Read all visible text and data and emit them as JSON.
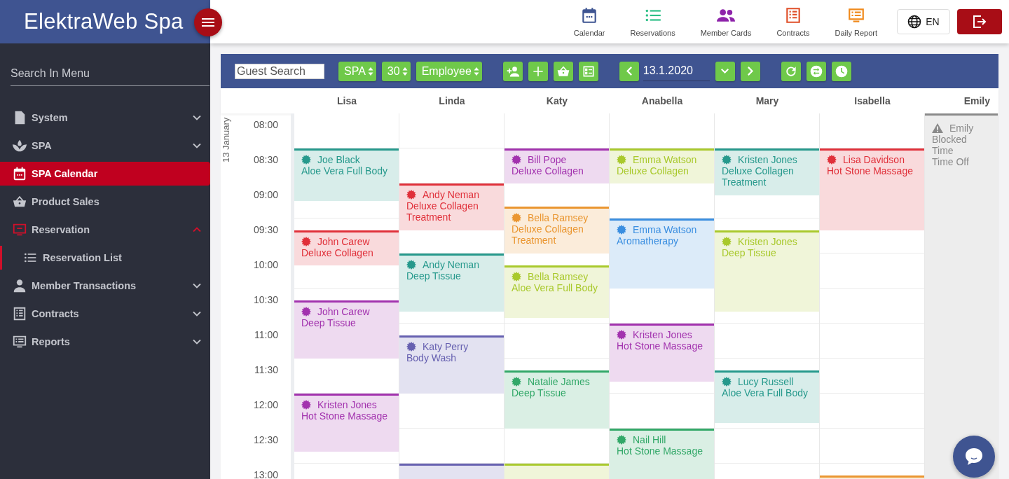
{
  "brand": {
    "title": "ElektraWeb Spa"
  },
  "top_nav": [
    {
      "label": "Calendar",
      "color": "#3f5592"
    },
    {
      "label": "Reservations",
      "color": "#2bbf86"
    },
    {
      "label": "Member Cards",
      "color": "#8e24aa"
    },
    {
      "label": "Contracts",
      "color": "#e0502a"
    },
    {
      "label": "Daily Report",
      "color": "#f08a1c"
    }
  ],
  "language": "EN",
  "sidebar": {
    "menu_search": {
      "placeholder": "Search In Menu"
    },
    "items": [
      {
        "label": "System",
        "kind": "group",
        "expanded": false,
        "selected": false
      },
      {
        "label": "SPA",
        "kind": "group",
        "expanded": false,
        "selected": false
      },
      {
        "label": "SPA Calendar",
        "kind": "link",
        "selected": true
      },
      {
        "label": "Product Sales",
        "kind": "link",
        "selected": false
      },
      {
        "label": "Reservation",
        "kind": "group",
        "expanded": true,
        "selected": false,
        "children": [
          {
            "label": "Reservation List",
            "selected": true
          }
        ]
      },
      {
        "label": "Member Transactions",
        "kind": "group",
        "expanded": false,
        "selected": false
      },
      {
        "label": "Contracts",
        "kind": "group",
        "expanded": false,
        "selected": false
      },
      {
        "label": "Reports",
        "kind": "group",
        "expanded": false,
        "selected": false
      }
    ]
  },
  "toolbar": {
    "guest_search": {
      "placeholder": "Guest Search"
    },
    "selects": [
      "SPA",
      "30",
      "Employee"
    ],
    "date": {
      "value": "13.1.2020"
    }
  },
  "calendar": {
    "date_label": "13 January",
    "times": [
      "08:00",
      "08:30",
      "09:00",
      "09:30",
      "10:00",
      "10:30",
      "11:00",
      "11:30",
      "12:00",
      "12:30",
      "13:00"
    ],
    "columns": [
      {
        "name": "Lisa",
        "appointments": [
          {
            "kind": "booking",
            "color": "#26998c",
            "customer": "Joe Black",
            "service": "Aloe Vera Full Body"
          },
          {
            "kind": "booking",
            "color": "#e0303a",
            "customer": "John Carew",
            "service": "Deluxe Collagen"
          },
          {
            "kind": "booking",
            "color": "#a232ae",
            "customer": "John Carew",
            "service": "Deep Tissue"
          },
          {
            "kind": "booking",
            "color": "#a232ae",
            "customer": "Kristen Jones",
            "service": "Hot Stone Massage"
          }
        ]
      },
      {
        "name": "Linda",
        "appointments": [
          {
            "kind": "booking",
            "color": "#e0303a",
            "customer": "Andy Neman",
            "service": "Deluxe Collagen Treatment"
          },
          {
            "kind": "booking",
            "color": "#26998c",
            "customer": "Andy Neman",
            "service": "Deep Tissue"
          },
          {
            "kind": "booking",
            "color": "#6660b0",
            "customer": "Katy Perry",
            "service": "Body Wash"
          },
          {
            "kind": "booking",
            "color": "#6660b0"
          }
        ]
      },
      {
        "name": "Katy",
        "appointments": [
          {
            "kind": "booking",
            "color": "#a232ae",
            "customer": "Bill Pope",
            "service": "Deluxe Collagen"
          },
          {
            "kind": "booking",
            "color": "#ea9630",
            "customer": "Bella Ramsey",
            "service": "Deluxe Collagen Treatment"
          },
          {
            "kind": "booking",
            "color": "#a9c92c",
            "customer": "Bella Ramsey",
            "service": "Aloe Vera Full Body"
          },
          {
            "kind": "booking",
            "color": "#32a868",
            "customer": "Natalie James",
            "service": "Deep Tissue"
          },
          {
            "kind": "booking",
            "color": "#a9c92c"
          }
        ]
      },
      {
        "name": "Anabella",
        "appointments": [
          {
            "kind": "booking",
            "color": "#a9c92c",
            "customer": "Emma Watson",
            "service": "Deluxe Collagen"
          },
          {
            "kind": "booking",
            "color": "#3a8ee0",
            "customer": "Emma Watson",
            "service": "Aromatherapy"
          },
          {
            "kind": "booking",
            "color": "#a232ae",
            "customer": "Kristen Jones",
            "service": "Hot Stone Massage"
          },
          {
            "kind": "booking",
            "color": "#32a868",
            "customer": "Nail Hill",
            "service": "Hot Stone Massage"
          }
        ]
      },
      {
        "name": "Mary",
        "appointments": [
          {
            "kind": "booking",
            "color": "#26998c",
            "customer": "Kristen Jones",
            "service": "Deluxe Collagen Treatment"
          },
          {
            "kind": "booking",
            "color": "#a9c92c",
            "customer": "Kristen Jones",
            "service": "Deep Tissue"
          },
          {
            "kind": "booking",
            "color": "#26998c",
            "customer": "Lucy Russell",
            "service": "Aloe Vera Full Body"
          }
        ]
      },
      {
        "name": "Isabella",
        "appointments": [
          {
            "kind": "booking",
            "color": "#e0303a",
            "customer": "Lisa Davidson",
            "service": "Hot Stone Massage"
          },
          {
            "kind": "booking",
            "color": "#ea9630"
          }
        ]
      },
      {
        "name": "Emily",
        "appointments": [
          {
            "kind": "blocked",
            "color": "#8a8a8a",
            "customer": "Emily",
            "service": "Blocked Time",
            "note": "Time Off"
          }
        ]
      }
    ]
  }
}
